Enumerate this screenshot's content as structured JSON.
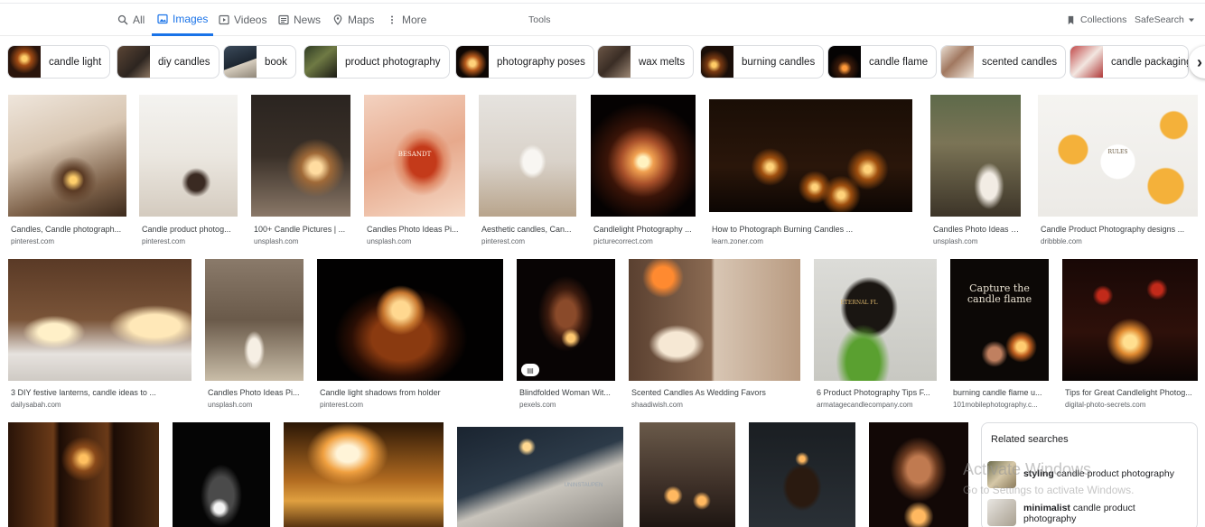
{
  "nav": {
    "all": "All",
    "images": "Images",
    "videos": "Videos",
    "news": "News",
    "maps": "Maps",
    "more": "More",
    "tools": "Tools",
    "collections": "Collections",
    "safesearch": "SafeSearch"
  },
  "chips": [
    {
      "label": "candle light"
    },
    {
      "label": "diy candles"
    },
    {
      "label": "book"
    },
    {
      "label": "product photography"
    },
    {
      "label": "photography poses"
    },
    {
      "label": "wax melts"
    },
    {
      "label": "burning candles"
    },
    {
      "label": "candle flame"
    },
    {
      "label": "scented candles"
    },
    {
      "label": "candle packaging"
    }
  ],
  "results": [
    {
      "caption": "Candles, Candle photograph...",
      "source": "pinterest.com"
    },
    {
      "caption": "Candle product photog...",
      "source": "pinterest.com"
    },
    {
      "caption": "100+ Candle Pictures | ...",
      "source": "unsplash.com"
    },
    {
      "caption": "Candles Photo Ideas Pi...",
      "source": "unsplash.com"
    },
    {
      "caption": "Aesthetic candles, Can...",
      "source": "pinterest.com"
    },
    {
      "caption": "Candlelight Photography ...",
      "source": "picturecorrect.com"
    },
    {
      "caption": "How to Photograph Burning Candles ...",
      "source": "learn.zoner.com"
    },
    {
      "caption": "Candles Photo Ideas Pi...",
      "source": "unsplash.com"
    },
    {
      "caption": "Candle Product Photography designs ...",
      "source": "dribbble.com"
    },
    {
      "caption": "3 DIY festive lanterns, candle ideas to ...",
      "source": "dailysabah.com"
    },
    {
      "caption": "Candles Photo Ideas Pi...",
      "source": "unsplash.com"
    },
    {
      "caption": "Candle light shadows from holder",
      "source": "pinterest.com"
    },
    {
      "caption": "Blindfolded Woman Wit...",
      "source": "pexels.com"
    },
    {
      "caption": "Scented Candles As Wedding Favors",
      "source": "shaadiwish.com"
    },
    {
      "caption": "6 Product Photography Tips F...",
      "source": "armatagecandlecompany.com"
    },
    {
      "caption": "burning candle flame u...",
      "source": "101mobilephotography.c..."
    },
    {
      "caption": "Tips for Great Candlelight Photog...",
      "source": "digital-photo-secrets.com"
    }
  ],
  "image_text": {
    "capture_line1": "Capture the",
    "capture_line2": "candle flame",
    "label_besandt": "BESANDT",
    "label_unknown": "UNINSTAUPEN",
    "label_rules": "RULES",
    "label_eternal": "ETERNAL FL"
  },
  "related": {
    "title": "Related searches",
    "items": [
      {
        "bold": "styling",
        "rest": " candle product photography"
      },
      {
        "bold": "minimalist",
        "rest": " candle product",
        "line2": "photography"
      }
    ]
  },
  "watermark": {
    "line1": "Activate Windows",
    "line2": "Go to Settings to activate Windows."
  }
}
